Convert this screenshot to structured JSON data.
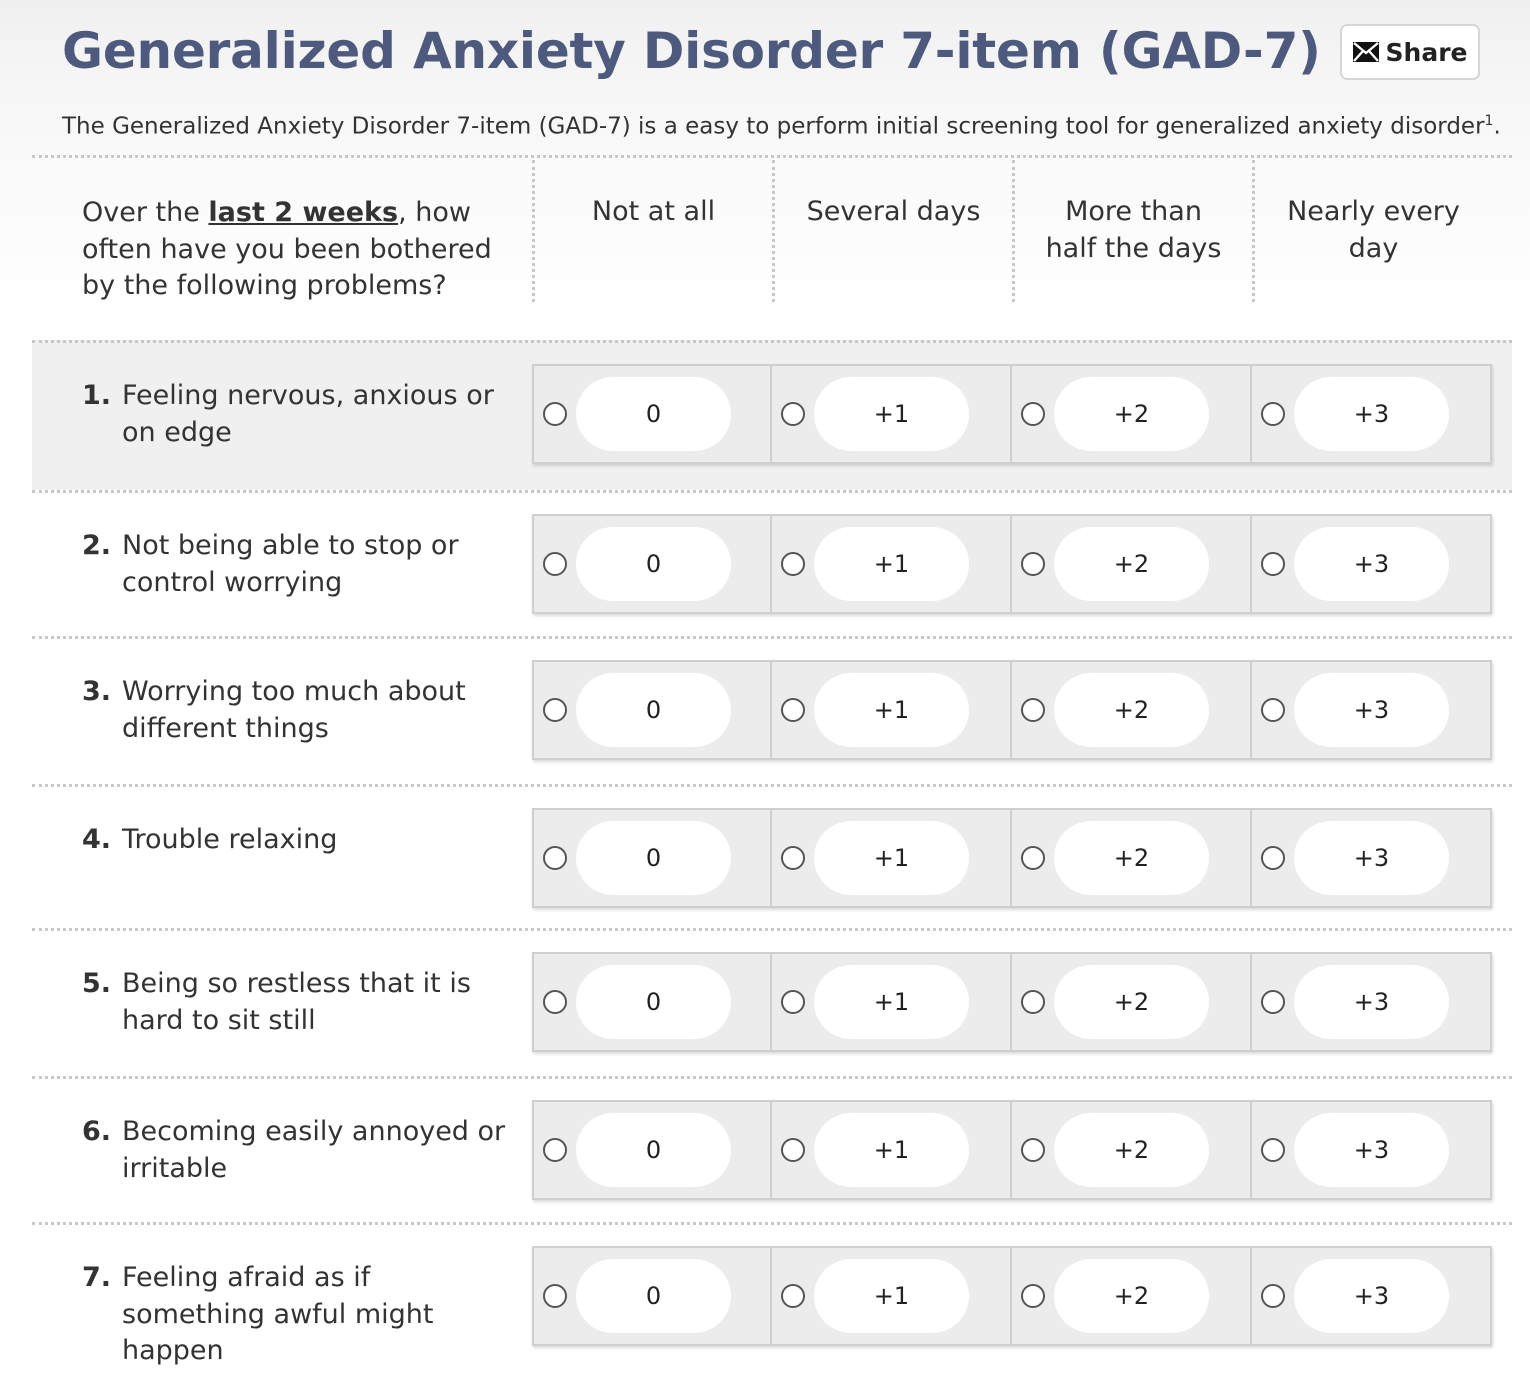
{
  "header": {
    "title": "Generalized Anxiety Disorder 7-item (GAD-7)",
    "share_label": "Share",
    "share_icon": "envelope-icon",
    "subtitle": "The Generalized Anxiety Disorder 7-item (GAD-7) is a easy to perform initial screening tool for generalized anxiety disorder",
    "subtitle_ref": "1",
    "subtitle_end": "."
  },
  "table_header": {
    "question_pre": "Over the ",
    "question_emph": "last 2 weeks",
    "question_post": ", how often have you been bothered by the following problems?",
    "columns": [
      "Not at all",
      "Several days",
      "More than half the days",
      "Nearly every day"
    ]
  },
  "option_values": [
    "0",
    "+1",
    "+2",
    "+3"
  ],
  "questions": [
    {
      "num": "1.",
      "text": "Feeling nervous, anxious or on edge",
      "highlighted": true
    },
    {
      "num": "2.",
      "text": "Not being able to stop or control worrying",
      "highlighted": false
    },
    {
      "num": "3.",
      "text": "Worrying too much about different things",
      "highlighted": false
    },
    {
      "num": "4.",
      "text": "Trouble relaxing",
      "highlighted": false
    },
    {
      "num": "5.",
      "text": "Being so restless that it is hard to sit still",
      "highlighted": false
    },
    {
      "num": "6.",
      "text": "Becoming easily annoyed or irritable",
      "highlighted": false
    },
    {
      "num": "7.",
      "text": "Feeling afraid as if something awful might happen",
      "highlighted": false
    }
  ],
  "colors": {
    "title": "#4d5a7d",
    "row_highlight": "#f0f0f0",
    "option_cell": "#ececec",
    "option_pill": "#ffffff"
  }
}
